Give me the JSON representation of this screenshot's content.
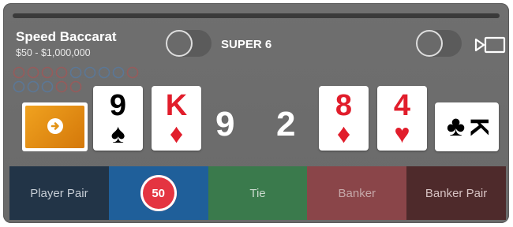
{
  "game": {
    "title": "Speed Baccarat",
    "limits": "$50 - $1,000,000"
  },
  "toggles": {
    "super6_label": "SUPER 6",
    "super6_on": false,
    "view_on": false
  },
  "player_cards": [
    {
      "rank": "9",
      "suit": "♠",
      "color": "#000000"
    },
    {
      "rank": "K",
      "suit": "♦",
      "color": "#e11d2b"
    }
  ],
  "player_score": "9",
  "banker_score": "2",
  "banker_cards": [
    {
      "rank": "8",
      "suit": "♦",
      "color": "#e11d2b"
    },
    {
      "rank": "4",
      "suit": "♥",
      "color": "#e11d2b"
    },
    {
      "rank": "K",
      "suit": "♣",
      "color": "#000000"
    }
  ],
  "bets": [
    {
      "label": "Player Pair",
      "bg": "#223447",
      "color": "#c5ccd4"
    },
    {
      "label": "",
      "bg": "#1f5f9a",
      "color": "#ffffff",
      "chip": "50"
    },
    {
      "label": "Tie",
      "bg": "#3a7a4c",
      "color": "#c9d9cc"
    },
    {
      "label": "Banker",
      "bg": "#8a4549",
      "color": "#c6a8a9"
    },
    {
      "label": "Banker Pair",
      "bg": "#4e2a2b",
      "color": "#d6c2c2"
    }
  ],
  "icons": {
    "deck": "card-back-icon",
    "view": "video-view-icon"
  }
}
